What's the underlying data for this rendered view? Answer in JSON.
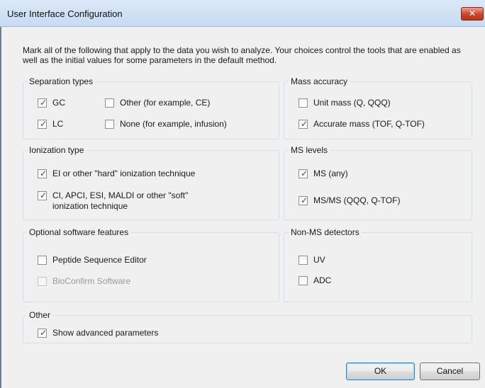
{
  "window": {
    "title": "User Interface Configuration",
    "close_label": "✕"
  },
  "intro_text": "Mark all of the following that apply to the data you wish to analyze. Your choices control the tools that are enabled as well as the initial values for some parameters in the default method.",
  "separation_types": {
    "label": "Separation types",
    "items": [
      {
        "label": "GC",
        "checked": true,
        "enabled": true
      },
      {
        "label": "Other (for example, CE)",
        "checked": false,
        "enabled": true
      },
      {
        "label": "LC",
        "checked": true,
        "enabled": true
      },
      {
        "label": "None (for example, infusion)",
        "checked": false,
        "enabled": true
      }
    ]
  },
  "mass_accuracy": {
    "label": "Mass accuracy",
    "items": [
      {
        "label": "Unit mass  (Q, QQQ)",
        "checked": false,
        "enabled": true
      },
      {
        "label": "Accurate mass  (TOF, Q-TOF)",
        "checked": true,
        "enabled": true
      }
    ]
  },
  "ionization_type": {
    "label": "Ionization type",
    "items": [
      {
        "label": "EI or other \"hard\" ionization technique",
        "checked": true,
        "enabled": true
      },
      {
        "label": "CI, APCI, ESI, MALDI or other \"soft\"",
        "label2": "ionization technique",
        "checked": true,
        "enabled": true
      }
    ]
  },
  "ms_levels": {
    "label": "MS levels",
    "items": [
      {
        "label": "MS  (any)",
        "checked": true,
        "enabled": true
      },
      {
        "label": "MS/MS  (QQQ, Q-TOF)",
        "checked": true,
        "enabled": true
      }
    ]
  },
  "optional_features": {
    "label": "Optional software features",
    "items": [
      {
        "label": "Peptide Sequence Editor",
        "checked": false,
        "enabled": true
      },
      {
        "label": "BioConfirm Software",
        "checked": false,
        "enabled": false
      }
    ]
  },
  "non_ms_detectors": {
    "label": "Non-MS detectors",
    "items": [
      {
        "label": "UV",
        "checked": false,
        "enabled": true
      },
      {
        "label": "ADC",
        "checked": false,
        "enabled": true
      }
    ]
  },
  "other": {
    "label": "Other",
    "items": [
      {
        "label": "Show advanced parameters",
        "checked": true,
        "enabled": true
      }
    ]
  },
  "buttons": {
    "ok": "OK",
    "cancel": "Cancel"
  },
  "checkmark_glyph": "✓"
}
